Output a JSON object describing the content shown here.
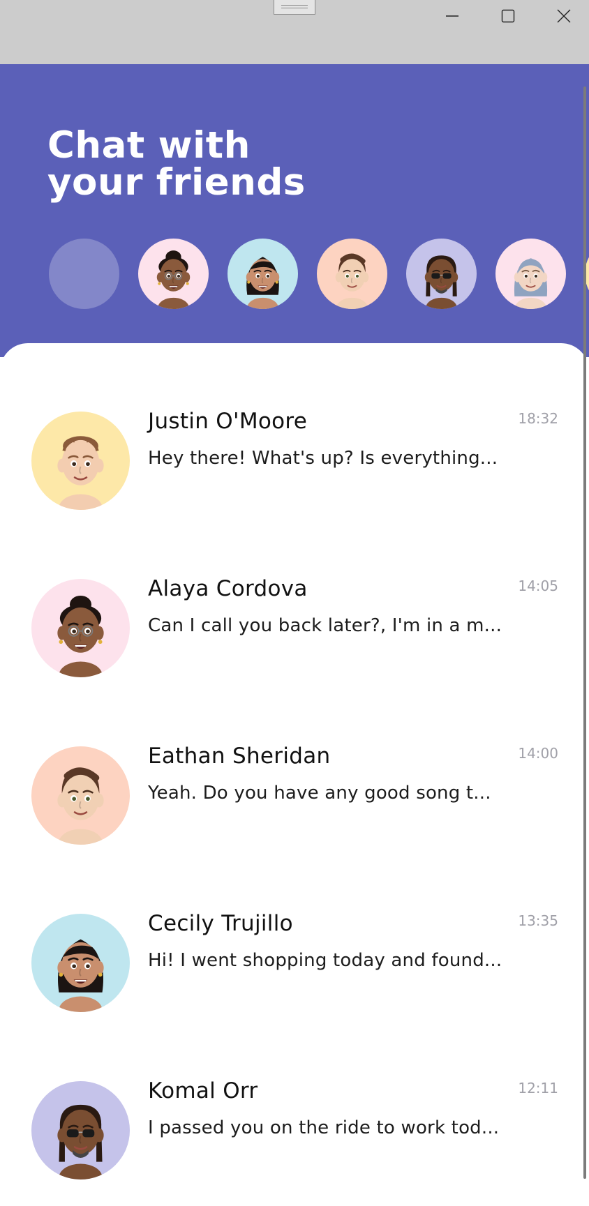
{
  "window": {
    "controls": {
      "minimize": "minimize-icon",
      "maximize": "maximize-icon",
      "close": "close-icon"
    }
  },
  "header": {
    "title_line1": "Chat with",
    "title_line2": "your friends",
    "background": "#5b60b8"
  },
  "stories": [
    {
      "name": "add-story",
      "bg": "#8387c9",
      "avatar": "empty"
    },
    {
      "name": "story-alaya",
      "bg": "#fde2ec",
      "avatar": "alaya-memoji"
    },
    {
      "name": "story-cecily",
      "bg": "#bfe6ef",
      "avatar": "cecily-memoji"
    },
    {
      "name": "story-eathan",
      "bg": "#fdd3c1",
      "avatar": "eathan-memoji"
    },
    {
      "name": "story-komal",
      "bg": "#c5c3ea",
      "avatar": "komal-memoji"
    },
    {
      "name": "story-hijab",
      "bg": "#fde2ec",
      "avatar": "hijab-memoji"
    },
    {
      "name": "story-justin",
      "bg": "#fde8a8",
      "avatar": "justin-memoji"
    }
  ],
  "chats": [
    {
      "name": "Justin O'Moore",
      "preview": "Hey there! What's up? Is everything...",
      "time": "18:32",
      "bg": "#fde8a8",
      "avatar": "justin-memoji"
    },
    {
      "name": "Alaya Cordova",
      "preview": "Can I call you back later?, I'm in a m...",
      "time": "14:05",
      "bg": "#fde2ec",
      "avatar": "alaya-memoji"
    },
    {
      "name": "Eathan Sheridan",
      "preview": "Yeah. Do you have any good song t...",
      "time": "14:00",
      "bg": "#fdd3c1",
      "avatar": "eathan-memoji"
    },
    {
      "name": "Cecily Trujillo",
      "preview": "Hi! I went shopping today and found...",
      "time": "13:35",
      "bg": "#bfe6ef",
      "avatar": "cecily-memoji"
    },
    {
      "name": "Komal Orr",
      "preview": "I passed you on the ride to work tod...",
      "time": "12:11",
      "bg": "#c5c3ea",
      "avatar": "komal-memoji"
    }
  ]
}
